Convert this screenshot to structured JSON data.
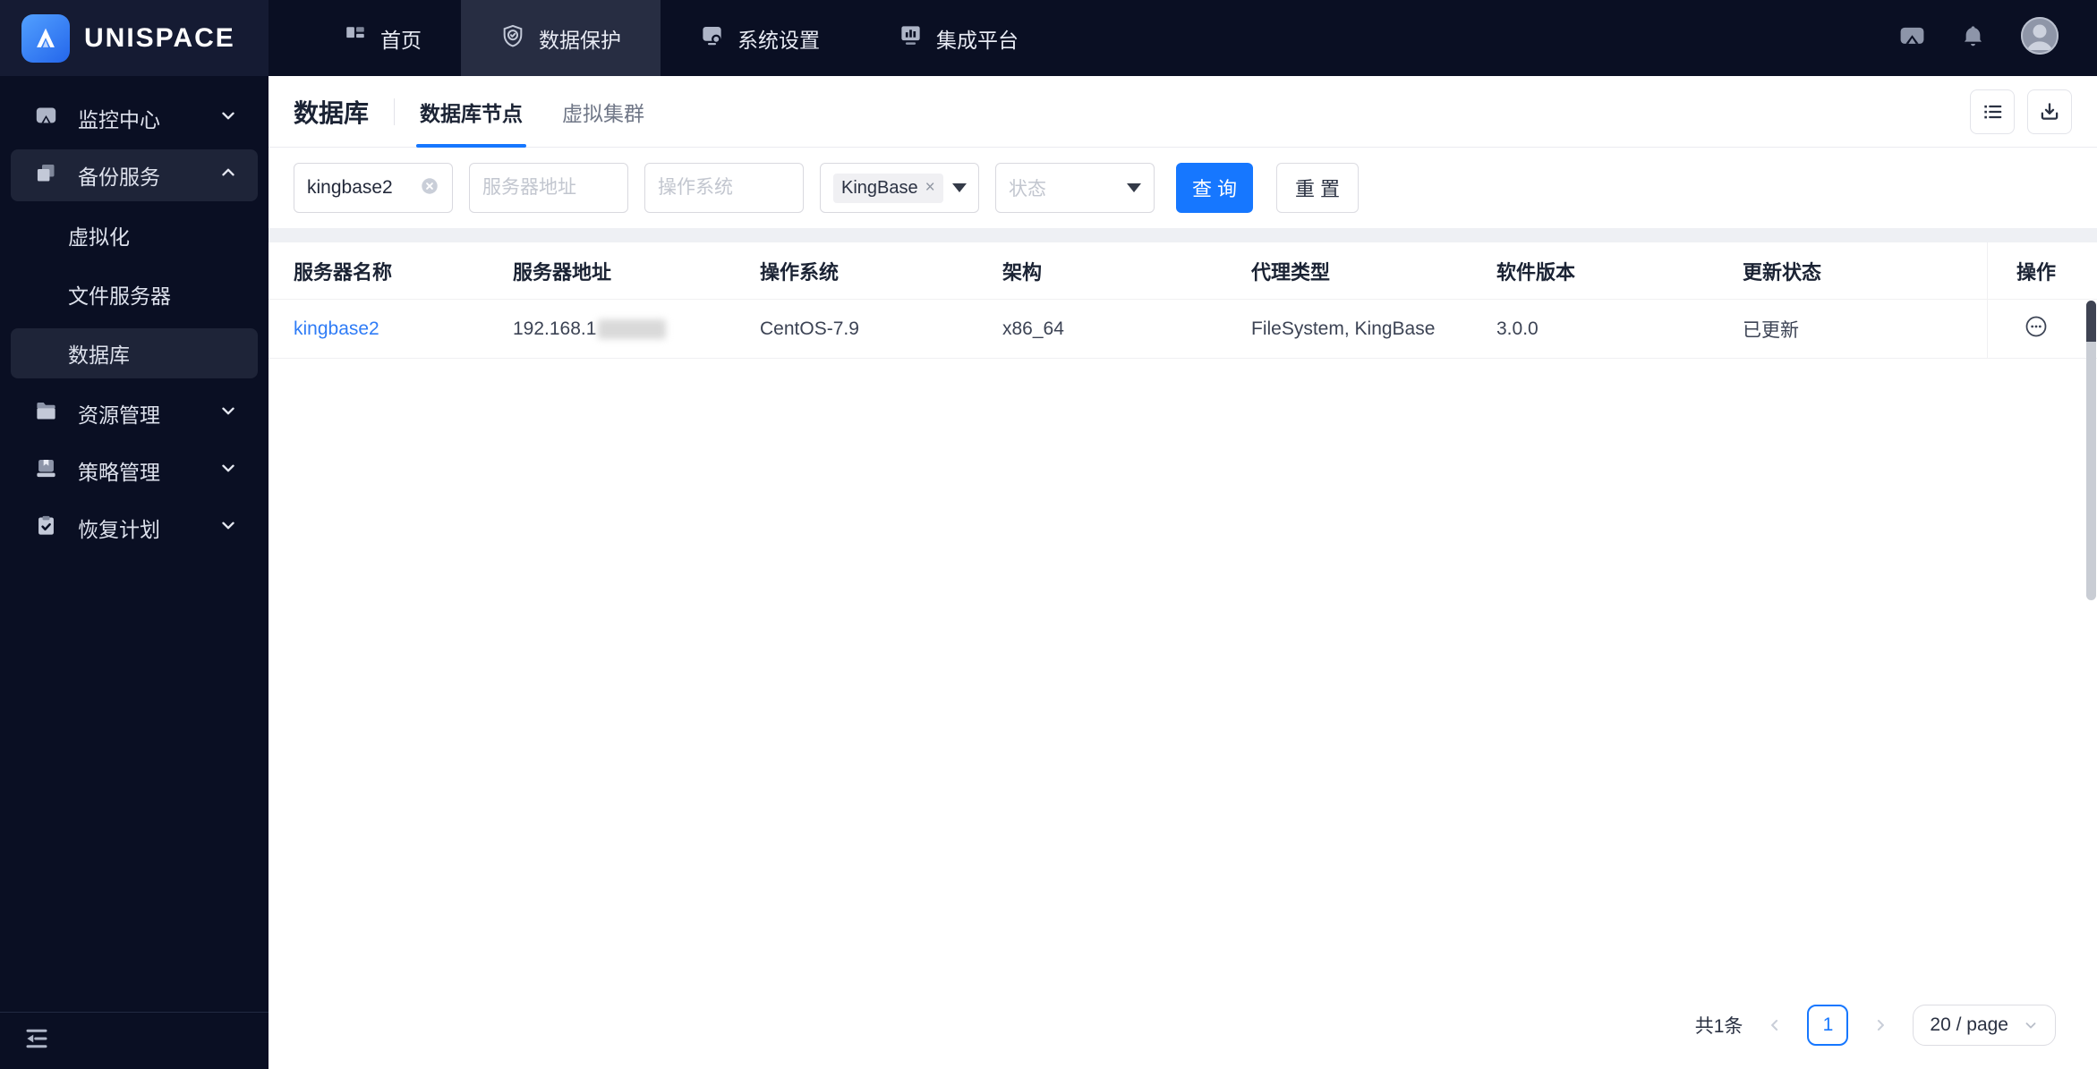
{
  "brand": {
    "name": "UNISPACE"
  },
  "topnav": {
    "items": [
      {
        "label": "首页",
        "icon": "home-grid-icon",
        "active": false
      },
      {
        "label": "数据保护",
        "icon": "shield-check-icon",
        "active": true
      },
      {
        "label": "系统设置",
        "icon": "system-settings-icon",
        "active": false
      },
      {
        "label": "集成平台",
        "icon": "integration-platform-icon",
        "active": false
      }
    ],
    "right_icons": [
      "message-icon",
      "bell-icon",
      "avatar"
    ]
  },
  "sidebar": {
    "items": [
      {
        "label": "监控中心",
        "icon": "monitor-icon",
        "state": "collapsed"
      },
      {
        "label": "备份服务",
        "icon": "backup-copy-icon",
        "state": "expanded"
      },
      {
        "label": "虚拟化",
        "type": "sub",
        "selected": false
      },
      {
        "label": "文件服务器",
        "type": "sub",
        "selected": false
      },
      {
        "label": "数据库",
        "type": "sub",
        "selected": true
      },
      {
        "label": "资源管理",
        "icon": "folder-icon",
        "state": "collapsed"
      },
      {
        "label": "策略管理",
        "icon": "policy-device-icon",
        "state": "collapsed"
      },
      {
        "label": "恢复计划",
        "icon": "clipboard-check-icon",
        "state": "collapsed"
      }
    ]
  },
  "page": {
    "title": "数据库",
    "tabs": [
      {
        "label": "数据库节点",
        "active": true
      },
      {
        "label": "虚拟集群",
        "active": false
      }
    ]
  },
  "filters": {
    "server_name": {
      "value": "kingbase2"
    },
    "server_address": {
      "placeholder": "服务器地址"
    },
    "os": {
      "placeholder": "操作系统"
    },
    "agent_type": {
      "tag": "KingBase"
    },
    "status": {
      "placeholder": "状态"
    },
    "search_label": "查 询",
    "reset_label": "重 置"
  },
  "table": {
    "columns": [
      "服务器名称",
      "服务器地址",
      "操作系统",
      "架构",
      "代理类型",
      "软件版本",
      "更新状态",
      "操作"
    ],
    "rows": [
      {
        "server_name": "kingbase2",
        "server_address_visible": "192.168.1",
        "server_address_redacted": true,
        "os": "CentOS-7.9",
        "arch": "x86_64",
        "agent_type": "FileSystem, KingBase",
        "version": "3.0.0",
        "update_status": "已更新"
      }
    ]
  },
  "pagination": {
    "total": "共1条",
    "current_page": "1",
    "page_size": "20 / page"
  },
  "colors": {
    "accent_blue": "#1677ff",
    "dark_navy": "#0a0f23",
    "link_blue": "#2f7cf6",
    "band_gray": "#eef0f4"
  }
}
